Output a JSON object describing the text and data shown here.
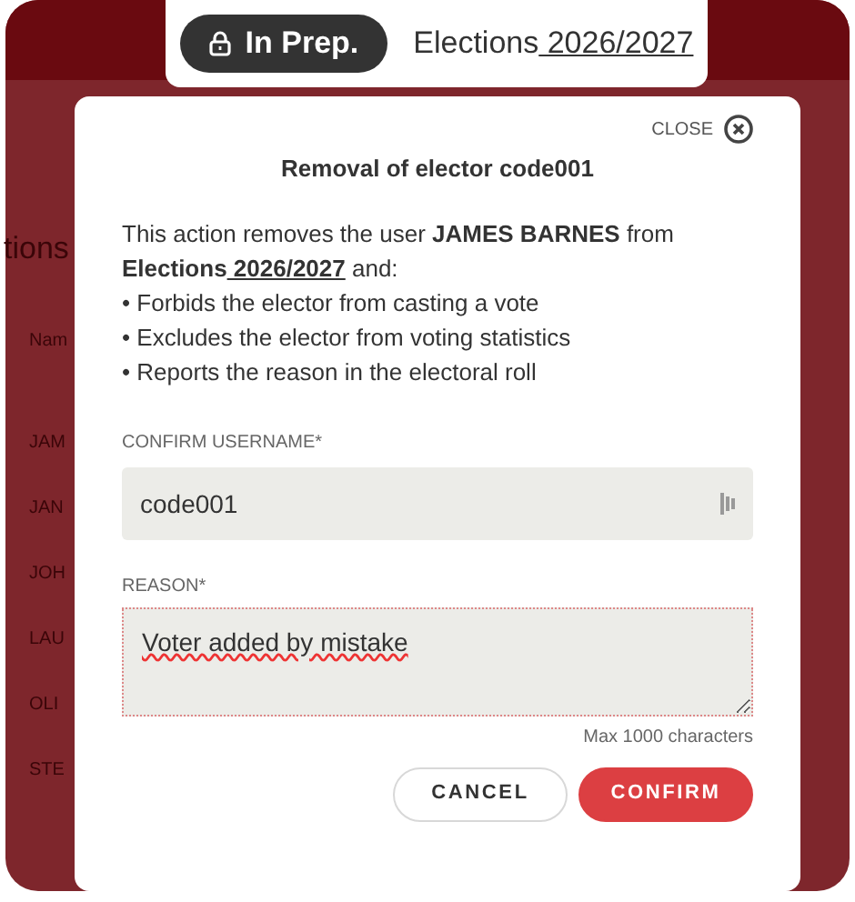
{
  "header": {
    "status": "In Prep.",
    "title": "Elections",
    "title_link": " 2026/2027"
  },
  "background": {
    "section_title": "tions",
    "column_header": "Nam",
    "rows": [
      "JAM",
      "JAN",
      "JOH",
      "LAU",
      "OLI",
      "STE"
    ]
  },
  "modal": {
    "close_label": "CLOSE",
    "title": "Removal of elector code001",
    "description": [
      {
        "kind": "plain",
        "text": "This action removes the user "
      },
      {
        "kind": "bold",
        "text": "JAMES BARNES"
      },
      {
        "kind": "plain",
        "text": " from "
      },
      {
        "kind": "bold",
        "text": "Elections"
      },
      {
        "kind": "link",
        "text": " 2026/2027"
      },
      {
        "kind": "plain",
        "text": " and:"
      }
    ],
    "bullets": [
      "• Forbids the elector from casting a vote",
      "• Excludes the elector from voting statistics",
      "• Reports the reason in the electoral roll"
    ],
    "username": {
      "label": "CONFIRM USERNAME*",
      "value": "code001"
    },
    "reason": {
      "label": "REASON*",
      "value": "Voter added by mistake",
      "hint": "Max 1000 characters"
    },
    "buttons": [
      {
        "kind": "secondary",
        "label": "CANCEL"
      },
      {
        "kind": "primary",
        "label": "CONFIRM"
      }
    ]
  }
}
